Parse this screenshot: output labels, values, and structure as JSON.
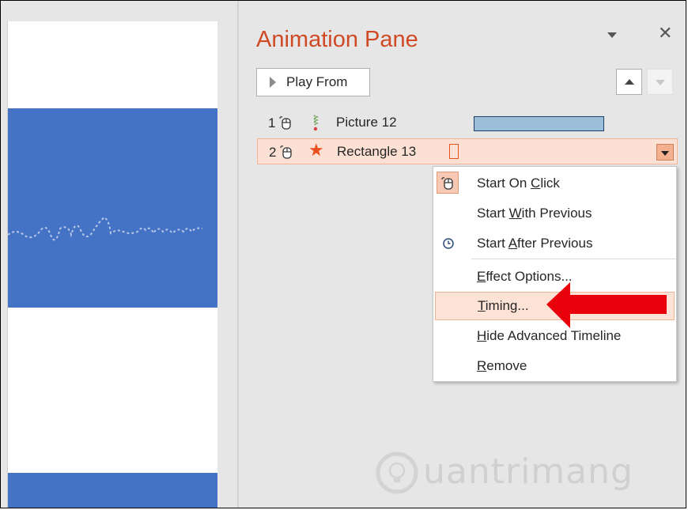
{
  "pane": {
    "title": "Animation Pane",
    "play_from": "Play From"
  },
  "animations": [
    {
      "order": "1",
      "name": "Picture 12",
      "trigger_icon": "mouse-click-icon",
      "effect_icon": "zigzag-motion-icon"
    },
    {
      "order": "2",
      "name": "Rectangle 13",
      "trigger_icon": "mouse-click-icon",
      "effect_icon": "star-emphasis-icon",
      "selected": true
    }
  ],
  "context_menu": {
    "items": [
      {
        "pre": "Start On ",
        "key": "C",
        "post": "lick",
        "icon": "mouse-click-icon",
        "checked": true
      },
      {
        "pre": "Start ",
        "key": "W",
        "post": "ith Previous",
        "icon": ""
      },
      {
        "pre": "Start ",
        "key": "A",
        "post": "fter Previous",
        "icon": "clock-icon"
      },
      {
        "pre": "",
        "key": "E",
        "post": "ffect Options...",
        "icon": ""
      },
      {
        "pre": "",
        "key": "T",
        "post": "iming...",
        "icon": "",
        "highlighted": true
      },
      {
        "pre": "",
        "key": "H",
        "post": "ide Advanced Timeline",
        "icon": ""
      },
      {
        "pre": "",
        "key": "R",
        "post": "emove",
        "icon": ""
      }
    ]
  },
  "watermark": "uantrimang",
  "colors": {
    "accent": "#d04a26",
    "slide_band": "#4472c4",
    "selection": "#fde0d4",
    "arrow": "#e8000b"
  }
}
